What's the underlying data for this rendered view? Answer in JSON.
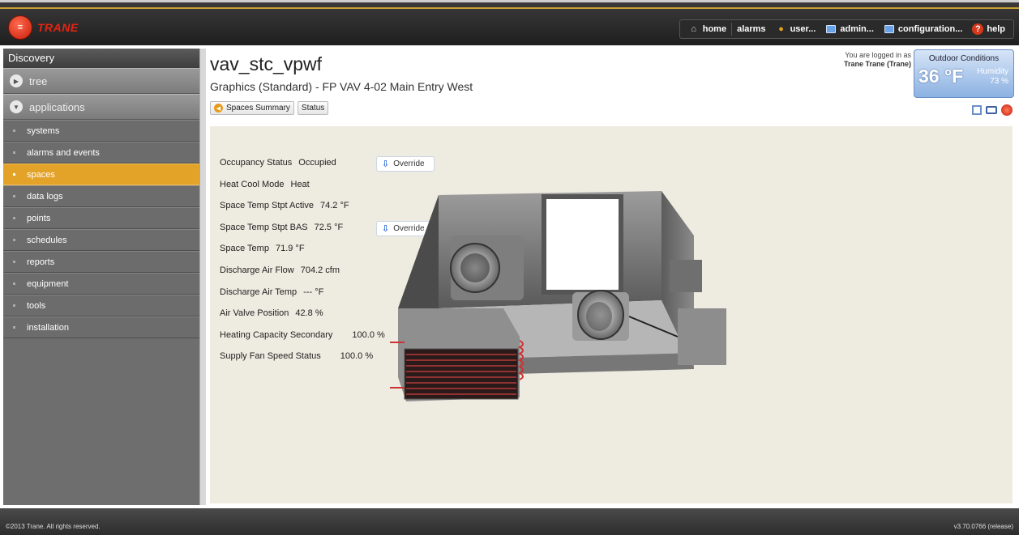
{
  "logo": {
    "text": "TRANE"
  },
  "nav": [
    {
      "label": "home",
      "icon": "home-icon"
    },
    {
      "label": "alarms",
      "icon": ""
    },
    {
      "label": "user...",
      "icon": "user-icon"
    },
    {
      "label": "admin...",
      "icon": "monitor-icon"
    },
    {
      "label": "configuration...",
      "icon": "monitor-icon"
    },
    {
      "label": "help",
      "icon": "help-icon"
    }
  ],
  "sidebar": {
    "header": "Discovery",
    "tree_label": "tree",
    "applications_label": "applications",
    "items": [
      {
        "label": "systems",
        "active": false
      },
      {
        "label": "alarms and events",
        "active": false
      },
      {
        "label": "spaces",
        "active": true
      },
      {
        "label": "data logs",
        "active": false
      },
      {
        "label": "points",
        "active": false
      },
      {
        "label": "schedules",
        "active": false
      },
      {
        "label": "reports",
        "active": false
      },
      {
        "label": "equipment",
        "active": false
      },
      {
        "label": "tools",
        "active": false
      },
      {
        "label": "installation",
        "active": false
      }
    ]
  },
  "page": {
    "title": "vav_stc_vpwf",
    "subtitle": "Graphics (Standard) - FP VAV 4-02 Main Entry West",
    "crumbs": {
      "back": "Spaces Summary",
      "status": "Status"
    }
  },
  "login": {
    "line1": "You are logged in as",
    "user": "Trane Trane (Trane)"
  },
  "outdoor": {
    "title": "Outdoor Conditions",
    "temp": "36 °F",
    "humidity_label": "Humidity",
    "humidity_value": "73 %"
  },
  "points": [
    {
      "label": "Occupancy Status",
      "value": "Occupied"
    },
    {
      "label": "Heat Cool Mode",
      "value": "Heat"
    },
    {
      "label": "Space Temp Stpt Active",
      "value": "74.2 °F"
    },
    {
      "label": "Space Temp Stpt BAS",
      "value": "72.5 °F"
    },
    {
      "label": "Space Temp",
      "value": "71.9 °F"
    },
    {
      "label": "Discharge Air Flow",
      "value": "704.2 cfm"
    },
    {
      "label": "Discharge Air Temp",
      "value": "--- °F"
    },
    {
      "label": "Air Valve Position",
      "value": "42.8 %"
    },
    {
      "label": "Heating Capacity Secondary",
      "value": "100.0 %"
    },
    {
      "label": "Supply Fan Speed Status",
      "value": "100.0 %"
    }
  ],
  "override_label": "Override",
  "footer": {
    "copyright": "©2013 Trane. All rights reserved.",
    "version": "v3.70.0766 (release)"
  }
}
